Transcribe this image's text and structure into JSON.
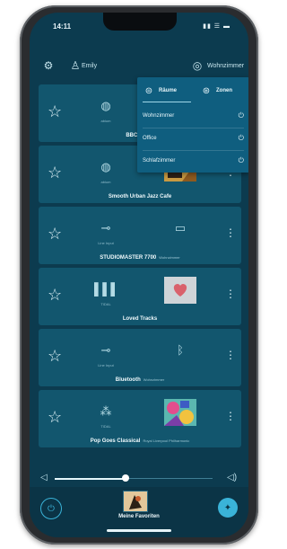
{
  "status": {
    "time": "14:11",
    "signal": "▮▮ ☰ ▬"
  },
  "header": {
    "user": "Emily",
    "room": "Wohnzimmer"
  },
  "dropdown": {
    "tabs": [
      {
        "label": "Räume"
      },
      {
        "label": "Zonen"
      }
    ],
    "rooms": [
      {
        "label": "Wohnzimmer"
      },
      {
        "label": "Office"
      },
      {
        "label": "Schlafzimmer"
      }
    ]
  },
  "cards": [
    {
      "title": "BBC Radio",
      "sub": "",
      "source": "abium"
    },
    {
      "title": "Smooth Urban Jazz Cafe",
      "sub": "",
      "source": "abium"
    },
    {
      "title": "STUDIOMASTER 7700",
      "sub": "Wohnzimmer",
      "source": "Line Input"
    },
    {
      "title": "Loved Tracks",
      "sub": "",
      "source": "TIDAL"
    },
    {
      "title": "Bluetooth",
      "sub": "Wohnzimmer",
      "source": "Line Input"
    },
    {
      "title": "Pop Goes Classical",
      "sub": "Royal Liverpool Philharmonic",
      "source": "TIDAL"
    }
  ],
  "player": {
    "volume_percent": 45
  },
  "footer": {
    "favorites_label": "Meine Favoriten"
  },
  "colors": {
    "background": "#0c3b4f",
    "card": "#12566e",
    "dropdown": "#0f5e7f",
    "accent": "#3ab3d8"
  }
}
